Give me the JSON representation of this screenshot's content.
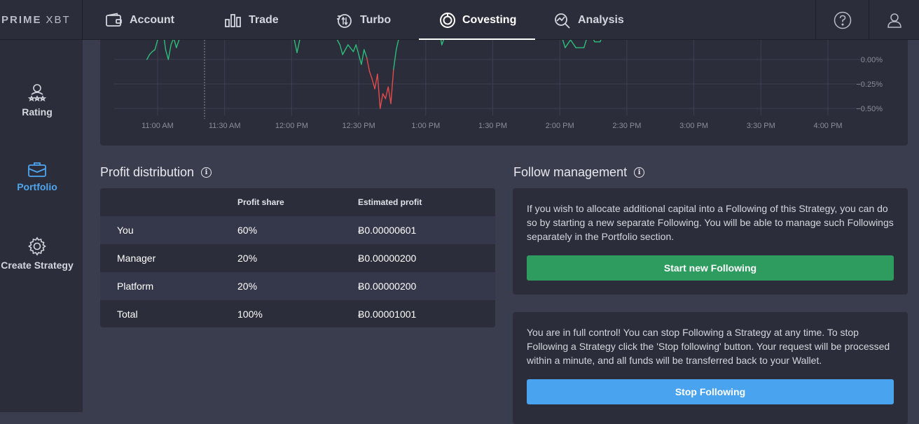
{
  "logo": {
    "bold": "PRIME",
    "thin": "XBT"
  },
  "nav": {
    "tabs": [
      {
        "label": "Account",
        "icon": "wallet-icon"
      },
      {
        "label": "Trade",
        "icon": "bar-chart-icon"
      },
      {
        "label": "Turbo",
        "icon": "turbo-icon"
      },
      {
        "label": "Covesting",
        "icon": "covesting-icon"
      },
      {
        "label": "Analysis",
        "icon": "analysis-icon"
      }
    ],
    "active": "Covesting",
    "help_icon": "question-circle-icon",
    "user_icon": "user-icon"
  },
  "sidebar": {
    "items": [
      {
        "label": "Rating",
        "icon": "rating-icon"
      },
      {
        "label": "Portfolio",
        "icon": "portfolio-icon"
      },
      {
        "label": "Create Strategy",
        "icon": "gear-icon"
      }
    ],
    "active": "Portfolio"
  },
  "chart_data": {
    "type": "line",
    "x_ticks": [
      "11:00 AM",
      "11:30 AM",
      "12:00 PM",
      "12:30 PM",
      "1:00 PM",
      "1:30 PM",
      "2:00 PM",
      "2:30 PM",
      "3:00 PM",
      "3:30 PM",
      "4:00 PM"
    ],
    "y_ticks": [
      "0.00%",
      "−0.25%",
      "−0.50%"
    ],
    "ylim": [
      -0.6,
      0.45
    ],
    "colors": {
      "positive": "#2ebd7a",
      "negative": "#e24c4c",
      "grid": "#3d4050",
      "marker": "#8a8d9a"
    },
    "series": [
      {
        "points": [
          [
            10.92,
            0.0
          ],
          [
            10.94,
            0.05
          ],
          [
            10.96,
            0.08
          ],
          [
            10.98,
            0.1
          ],
          [
            11.0,
            0.2
          ],
          [
            11.02,
            0.25
          ],
          [
            11.04,
            0.3
          ],
          [
            11.06,
            0.1
          ],
          [
            11.08,
            0.0
          ],
          [
            11.1,
            0.15
          ],
          [
            11.12,
            0.22
          ],
          [
            11.14,
            0.12
          ],
          [
            11.16,
            0.2
          ],
          [
            11.18,
            0.3
          ],
          [
            11.6,
            0.3
          ],
          [
            12.0,
            0.3
          ],
          [
            12.02,
            0.2
          ],
          [
            12.04,
            0.07
          ],
          [
            12.06,
            0.2
          ],
          [
            12.1,
            0.3
          ],
          [
            12.3,
            0.3
          ],
          [
            12.36,
            0.15
          ],
          [
            12.38,
            0.05
          ],
          [
            12.42,
            0.15
          ],
          [
            12.46,
            0.08
          ],
          [
            12.48,
            0.15
          ],
          [
            12.5,
            0.05
          ],
          [
            12.52,
            -0.05
          ],
          [
            12.54,
            0.1
          ],
          [
            12.56,
            0.02
          ],
          [
            12.58,
            -0.12
          ],
          [
            12.6,
            -0.2
          ],
          [
            12.62,
            -0.3
          ],
          [
            12.64,
            -0.15
          ],
          [
            12.66,
            -0.5
          ],
          [
            12.68,
            -0.35
          ],
          [
            12.7,
            -0.4
          ],
          [
            12.72,
            -0.28
          ],
          [
            12.74,
            -0.45
          ],
          [
            12.76,
            -0.1
          ],
          [
            12.78,
            0.1
          ],
          [
            12.8,
            0.22
          ],
          [
            12.82,
            0.3
          ],
          [
            13.1,
            0.3
          ],
          [
            13.12,
            0.15
          ],
          [
            13.16,
            0.3
          ],
          [
            14.0,
            0.3
          ],
          [
            14.04,
            0.12
          ],
          [
            14.08,
            0.2
          ],
          [
            14.12,
            0.12
          ],
          [
            14.18,
            0.12
          ],
          [
            14.22,
            0.3
          ],
          [
            14.26,
            0.18
          ],
          [
            14.3,
            0.18
          ],
          [
            14.34,
            0.3
          ],
          [
            16.0,
            0.3
          ]
        ]
      }
    ],
    "marker_x": 11.35
  },
  "profit": {
    "title": "Profit distribution",
    "headers": {
      "name": "",
      "share": "Profit share",
      "estimated": "Estimated profit"
    },
    "rows": [
      {
        "name": "You",
        "share": "60%",
        "estimated": "Ƀ0.00000601"
      },
      {
        "name": "Manager",
        "share": "20%",
        "estimated": "Ƀ0.00000200"
      },
      {
        "name": "Platform",
        "share": "20%",
        "estimated": "Ƀ0.00000200"
      },
      {
        "name": "Total",
        "share": "100%",
        "estimated": "Ƀ0.00001001"
      }
    ]
  },
  "follow": {
    "title": "Follow management",
    "card1_text": "If you wish to allocate additional capital into a Following of this Strategy, you can do so by starting a new separate Following. You will be able to manage such Followings separately in the Portfolio section.",
    "card1_button": "Start new Following",
    "card2_text": "You are in full control! You can stop Following a Strategy at any time. To stop Following a Strategy click the 'Stop following' button. Your request will be processed within a minute, and all funds will be transferred back to your Wallet.",
    "card2_button": "Stop Following"
  }
}
